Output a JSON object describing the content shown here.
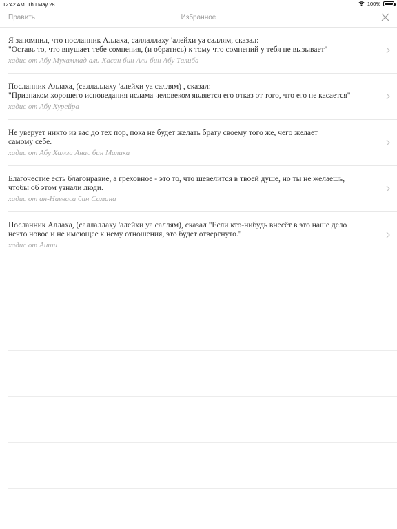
{
  "status": {
    "time": "12:42 AM",
    "date": "Thu May 28",
    "battery": "100%"
  },
  "nav": {
    "edit_label": "Править",
    "title": "Избранное"
  },
  "hadiths": [
    {
      "text": "Я запомнил, что посланник Аллаха, саллаллаху 'алейхи уа саллям, сказал:\n\"Оставь то, что внушает тебе сомнения, (и обратись) к тому что сомнений у тебя не вызывает\"",
      "source": "хадис от Абу Мухаммад аль-Хасан бин Али бин Абу Талиба"
    },
    {
      "text": "Посланник Аллаха, (саллаллаху 'алейхи уа саллям) , сказал:\n\"Признаком хорошего исповедания ислама человеком является его отказ от того, что его не касается\"",
      "source": "хадис от Абу Хурейра"
    },
    {
      "text": "Не уверует никто из вас до тех пор, пока не будет желать брату своему того же, чего желает\nсамому себе.",
      "source": "хадис от Абу Хамза Анас бин Малика"
    },
    {
      "text": "Благочестие есть благонравие, а греховное - это то, что шевелится в твоей душе, но ты не желаешь,\nчтобы об этом узнали люди.",
      "source": "хадис от ан-Навваса бин Самана"
    },
    {
      "text": "Посланник Аллаха, (саллаллаху 'алейхи уа саллям), сказал \"Если кто-нибудь внесёт в это наше дело\nнечто новое и не имеющее к нему отношения, это будет отвергнуто.\"",
      "source": "хадис от Аиши"
    }
  ]
}
